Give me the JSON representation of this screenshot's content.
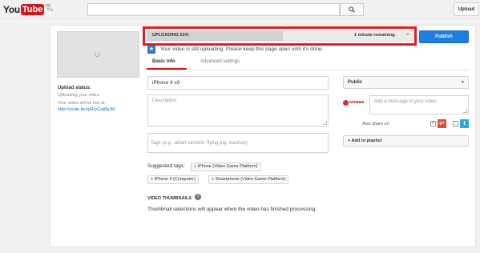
{
  "header": {
    "logo_you": "You",
    "logo_tube": "Tube",
    "logo_region": "VN",
    "search_placeholder": "",
    "upload_label": "Upload"
  },
  "sidebar": {
    "upload_status_label": "Upload status:",
    "upload_status_value": "Uploading your video.",
    "live_label": "Your video will be live at:",
    "live_url": "http://youtu.be/q8RyGat8gJM"
  },
  "progress": {
    "label": "UPLOADING 51%",
    "percent": 51,
    "remaining": "1 minute remaining.",
    "close_glyph": "×"
  },
  "publish_label": "Publish",
  "notice": "Your video is still uploading. Please keep this page open until it's done.",
  "tabs": [
    {
      "label": "Basic info",
      "active": true
    },
    {
      "label": "Advanced settings",
      "active": false
    }
  ],
  "form": {
    "title_value": "iPhone 4 c0",
    "description_placeholder": "Description",
    "tags_placeholder": "Tags (e.g., albert einstein, flying pig, mashup)",
    "suggested_label": "Suggested tags:",
    "suggested_tags": [
      "+ iPhone (Video Game Platform)",
      "+ iPhone 4 (Computer)",
      "+ Smartphone (Video Game Platform)"
    ],
    "thumbnails_heading": "VIDEO THUMBNAILS",
    "thumbnails_help": "?",
    "thumbnails_text": "Thumbnail selections will appear when the video has finished processing."
  },
  "right": {
    "privacy_value": "Public",
    "privacy_caret": "▼",
    "avatar_text": "ictnews",
    "message_placeholder": "Add a message to your video",
    "share_label": "Also share on",
    "gplus_glyph": "g+",
    "twitter_glyph": "t",
    "gplus_checked": true,
    "twitter_checked": false,
    "playlist_label": "+ Add to playlist"
  },
  "colors": {
    "accent_red": "#cc181e",
    "highlight_frame": "#e31b23",
    "publish_blue": "#1c7ee0"
  }
}
